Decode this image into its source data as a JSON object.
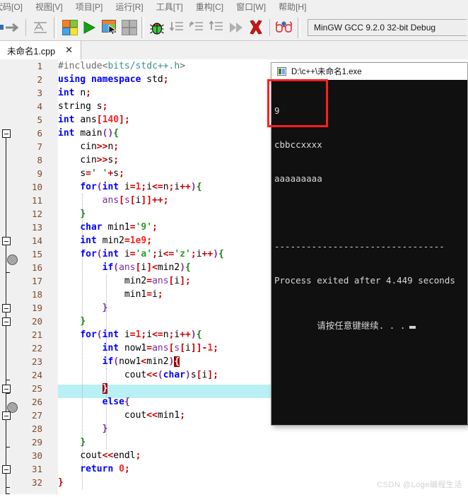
{
  "menu": {
    "items": [
      {
        "label": "代码[O]",
        "name": "menu-code"
      },
      {
        "label": "视图[V]",
        "name": "menu-view"
      },
      {
        "label": "项目[P]",
        "name": "menu-project"
      },
      {
        "label": "运行[R]",
        "name": "menu-run"
      },
      {
        "label": "工具[T]",
        "name": "menu-tools"
      },
      {
        "label": "重构[C]",
        "name": "menu-refactor"
      },
      {
        "label": "窗口[W]",
        "name": "menu-window"
      },
      {
        "label": "帮助[H]",
        "name": "menu-help"
      }
    ]
  },
  "toolbar": {
    "compiler_combo_value": "MinGW GCC 9.2.0 32-bit Debug",
    "icons": [
      "forward-arrow-icon",
      "format-code-icon",
      "build-icon",
      "run-icon",
      "build-and-run-icon",
      "rebuild-icon",
      "debug-icon",
      "step-into-icon",
      "step-over-icon",
      "step-out-icon",
      "continue-icon",
      "stop-execution-icon",
      "glasses-icon"
    ]
  },
  "tab": {
    "label": "未命名1.cpp",
    "close": "✕"
  },
  "editor": {
    "highlighted_line": 25,
    "breakpoint_lines": [
      11,
      22
    ],
    "line_count": 32,
    "lines": [
      {
        "n": 1,
        "indent": 0
      },
      {
        "n": 2,
        "indent": 0
      },
      {
        "n": 3,
        "indent": 0
      },
      {
        "n": 4,
        "indent": 0
      },
      {
        "n": 5,
        "indent": 0
      },
      {
        "n": 6,
        "indent": 0
      },
      {
        "n": 7,
        "indent": 1
      },
      {
        "n": 8,
        "indent": 1
      },
      {
        "n": 9,
        "indent": 1
      },
      {
        "n": 10,
        "indent": 1
      },
      {
        "n": 11,
        "indent": 2
      },
      {
        "n": 12,
        "indent": 1
      },
      {
        "n": 13,
        "indent": 1
      },
      {
        "n": 14,
        "indent": 1
      },
      {
        "n": 15,
        "indent": 1
      },
      {
        "n": 16,
        "indent": 2
      },
      {
        "n": 17,
        "indent": 3
      },
      {
        "n": 18,
        "indent": 3
      },
      {
        "n": 19,
        "indent": 2
      },
      {
        "n": 20,
        "indent": 1
      },
      {
        "n": 21,
        "indent": 1
      },
      {
        "n": 22,
        "indent": 2
      },
      {
        "n": 23,
        "indent": 2
      },
      {
        "n": 24,
        "indent": 3
      },
      {
        "n": 25,
        "indent": 2
      },
      {
        "n": 26,
        "indent": 2
      },
      {
        "n": 27,
        "indent": 3
      },
      {
        "n": 28,
        "indent": 2
      },
      {
        "n": 29,
        "indent": 1
      },
      {
        "n": 30,
        "indent": 1
      },
      {
        "n": 31,
        "indent": 1
      },
      {
        "n": 32,
        "indent": 0
      }
    ],
    "source_text": [
      "#include<bits/stdc++.h>",
      "using namespace std;",
      "int n;",
      "string s;",
      "int ans[140];",
      "int main(){",
      "    cin>>n;",
      "    cin>>s;",
      "    s=' '+s;",
      "    for(int i=1;i<=n;i++){",
      "        ans[s[i]]++;",
      "    }",
      "    char min1='9';",
      "    int min2=1e9;",
      "    for(int i='a';i<='z';i++){",
      "        if(ans[i]<min2){",
      "            min2=ans[i];",
      "            min1=i;",
      "        }",
      "    }",
      "    for(int i=1;i<=n;i++){",
      "        int now1=ans[s[i]]-1;",
      "        if(now1<min2){",
      "            cout<<(char)s[i];",
      "        }",
      "        else{",
      "            cout<<min1;",
      "        }",
      "    }",
      "    cout<<endl;",
      "    return 0;",
      "}"
    ]
  },
  "console": {
    "title": "D:\\c++\\未命名1.exe",
    "output_lines": [
      "9",
      "cbbccxxxx",
      "aaaaaaaaa",
      "",
      "--------------------------------",
      "Process exited after 4.449 seconds",
      "请按任意键继续. . ."
    ],
    "highlight_note": "red-annotation-box"
  },
  "watermark": {
    "text": "CSDN @Loge编程生活"
  },
  "colors": {
    "accent_red": "#ff1f1f",
    "keyword_blue": "#0000ff",
    "string_green": "#2a9a2a",
    "number_red": "#ff2222",
    "highlight_cyan": "#b8f0f4",
    "brace_match": "#9b0000",
    "console_bg": "#101010",
    "chrome_bg": "#f0f0f0"
  }
}
